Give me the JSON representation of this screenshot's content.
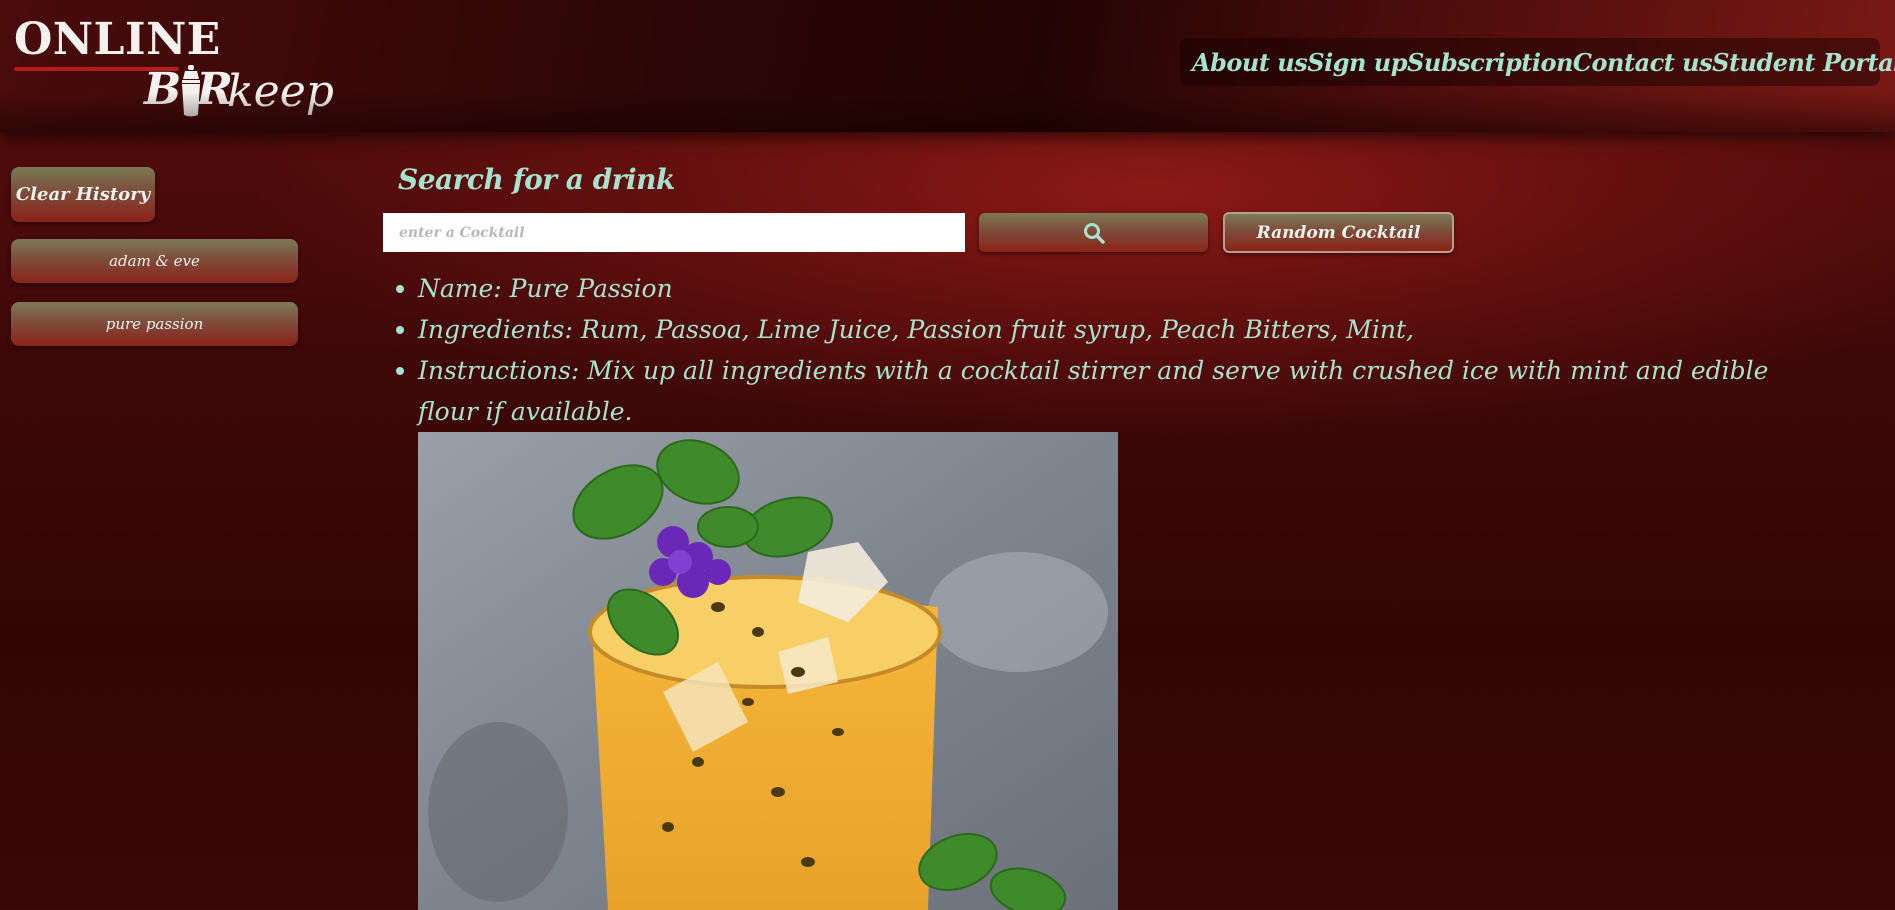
{
  "logo": {
    "line1": "ONLINE",
    "line2_bar": "B  R",
    "line2_keep": "keep"
  },
  "nav": {
    "items": [
      "About us",
      "Sign up",
      "Subscription",
      "Contact us",
      "Student Portal"
    ]
  },
  "sidebar": {
    "clear_label": "Clear History",
    "history": [
      "adam & eve",
      "pure passion"
    ]
  },
  "search": {
    "title": "Search for a drink",
    "placeholder": "enter a Cocktail",
    "value": "",
    "search_icon": "search-icon",
    "random_label": "Random Cocktail"
  },
  "drink": {
    "name_line": "Name: Pure Passion",
    "ingredients_line": "Ingredients: Rum, Passoa, Lime Juice, Passion fruit syrup, Peach Bitters, Mint,",
    "instructions_line": "Instructions: Mix up all ingredients with a cocktail stirrer and serve with crushed ice with mint and edible flour if available."
  },
  "colors": {
    "accent_text": "#a6e3cf",
    "background": "#3e0808",
    "button_top": "#7b7a55",
    "button_bottom": "#8a2318"
  }
}
